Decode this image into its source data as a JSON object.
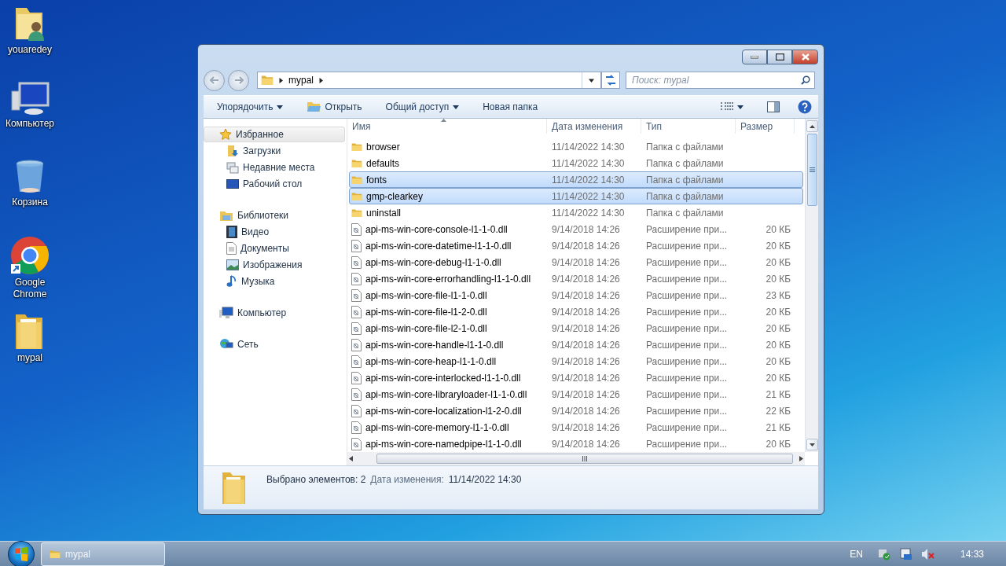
{
  "desktop_icons": [
    {
      "label": "youaredey",
      "kind": "user-folder"
    },
    {
      "label": "Компьютер",
      "kind": "computer"
    },
    {
      "label": "Корзина",
      "kind": "recycle"
    },
    {
      "label": "Google Chrome",
      "kind": "chrome"
    },
    {
      "label": "mypal",
      "kind": "folder"
    }
  ],
  "window": {
    "address": {
      "crumbs": [
        "mypal"
      ]
    },
    "search": {
      "placeholder": "Поиск: mypal"
    },
    "toolbar": [
      {
        "label": "Упорядочить",
        "kind": "menu"
      },
      {
        "label": "Открыть",
        "kind": "open"
      },
      {
        "label": "Общий доступ",
        "kind": "menu"
      },
      {
        "label": "Новая папка",
        "kind": "plain"
      }
    ],
    "nav": [
      {
        "label": "Избранное",
        "kind": "star",
        "selected": true,
        "children": [
          {
            "label": "Загрузки",
            "kind": "downloads"
          },
          {
            "label": "Недавние места",
            "kind": "recent"
          },
          {
            "label": "Рабочий стол",
            "kind": "desktop"
          }
        ]
      },
      {
        "label": "Библиотеки",
        "kind": "libraries",
        "selected": false,
        "children": [
          {
            "label": "Видео",
            "kind": "video"
          },
          {
            "label": "Документы",
            "kind": "documents"
          },
          {
            "label": "Изображения",
            "kind": "pictures"
          },
          {
            "label": "Музыка",
            "kind": "music"
          }
        ]
      },
      {
        "label": "Компьютер",
        "kind": "computer",
        "selected": false
      },
      {
        "label": "Сеть",
        "kind": "network",
        "selected": false
      }
    ],
    "columns": [
      "Имя",
      "Дата изменения",
      "Тип",
      "Размер"
    ],
    "rows": [
      {
        "name": "browser",
        "kind": "folder",
        "date": "11/14/2022 14:30",
        "type": "Папка с файлами",
        "selected": false
      },
      {
        "name": "defaults",
        "kind": "folder",
        "date": "11/14/2022 14:30",
        "type": "Папка с файлами",
        "selected": false
      },
      {
        "name": "fonts",
        "kind": "folder",
        "date": "11/14/2022 14:30",
        "type": "Папка с файлами",
        "selected": true
      },
      {
        "name": "gmp-clearkey",
        "kind": "folder",
        "date": "11/14/2022 14:30",
        "type": "Папка с файлами",
        "selected": true
      },
      {
        "name": "uninstall",
        "kind": "folder",
        "date": "11/14/2022 14:30",
        "type": "Папка с файлами",
        "selected": false
      },
      {
        "name": "api-ms-win-core-console-l1-1-0.dll",
        "kind": "dll",
        "date": "9/14/2018 14:26",
        "type": "Расширение при...",
        "size": "20 КБ",
        "selected": false
      },
      {
        "name": "api-ms-win-core-datetime-l1-1-0.dll",
        "kind": "dll",
        "date": "9/14/2018 14:26",
        "type": "Расширение при...",
        "size": "20 КБ",
        "selected": false
      },
      {
        "name": "api-ms-win-core-debug-l1-1-0.dll",
        "kind": "dll",
        "date": "9/14/2018 14:26",
        "type": "Расширение при...",
        "size": "20 КБ",
        "selected": false
      },
      {
        "name": "api-ms-win-core-errorhandling-l1-1-0.dll",
        "kind": "dll",
        "date": "9/14/2018 14:26",
        "type": "Расширение при...",
        "size": "20 КБ",
        "selected": false
      },
      {
        "name": "api-ms-win-core-file-l1-1-0.dll",
        "kind": "dll",
        "date": "9/14/2018 14:26",
        "type": "Расширение при...",
        "size": "23 КБ",
        "selected": false
      },
      {
        "name": "api-ms-win-core-file-l1-2-0.dll",
        "kind": "dll",
        "date": "9/14/2018 14:26",
        "type": "Расширение при...",
        "size": "20 КБ",
        "selected": false
      },
      {
        "name": "api-ms-win-core-file-l2-1-0.dll",
        "kind": "dll",
        "date": "9/14/2018 14:26",
        "type": "Расширение при...",
        "size": "20 КБ",
        "selected": false
      },
      {
        "name": "api-ms-win-core-handle-l1-1-0.dll",
        "kind": "dll",
        "date": "9/14/2018 14:26",
        "type": "Расширение при...",
        "size": "20 КБ",
        "selected": false
      },
      {
        "name": "api-ms-win-core-heap-l1-1-0.dll",
        "kind": "dll",
        "date": "9/14/2018 14:26",
        "type": "Расширение при...",
        "size": "20 КБ",
        "selected": false
      },
      {
        "name": "api-ms-win-core-interlocked-l1-1-0.dll",
        "kind": "dll",
        "date": "9/14/2018 14:26",
        "type": "Расширение при...",
        "size": "20 КБ",
        "selected": false
      },
      {
        "name": "api-ms-win-core-libraryloader-l1-1-0.dll",
        "kind": "dll",
        "date": "9/14/2018 14:26",
        "type": "Расширение при...",
        "size": "21 КБ",
        "selected": false
      },
      {
        "name": "api-ms-win-core-localization-l1-2-0.dll",
        "kind": "dll",
        "date": "9/14/2018 14:26",
        "type": "Расширение при...",
        "size": "22 КБ",
        "selected": false
      },
      {
        "name": "api-ms-win-core-memory-l1-1-0.dll",
        "kind": "dll",
        "date": "9/14/2018 14:26",
        "type": "Расширение при...",
        "size": "21 КБ",
        "selected": false
      },
      {
        "name": "api-ms-win-core-namedpipe-l1-1-0.dll",
        "kind": "dll",
        "date": "9/14/2018 14:26",
        "type": "Расширение при...",
        "size": "20 КБ",
        "selected": false
      }
    ],
    "status": {
      "count": "Выбрано элементов: 2",
      "date_label": "Дата изменения:",
      "date": "11/14/2022 14:30"
    }
  },
  "taskbar": {
    "tasks": [
      {
        "label": "mypal"
      }
    ],
    "language": "EN",
    "clock": "14:33"
  }
}
